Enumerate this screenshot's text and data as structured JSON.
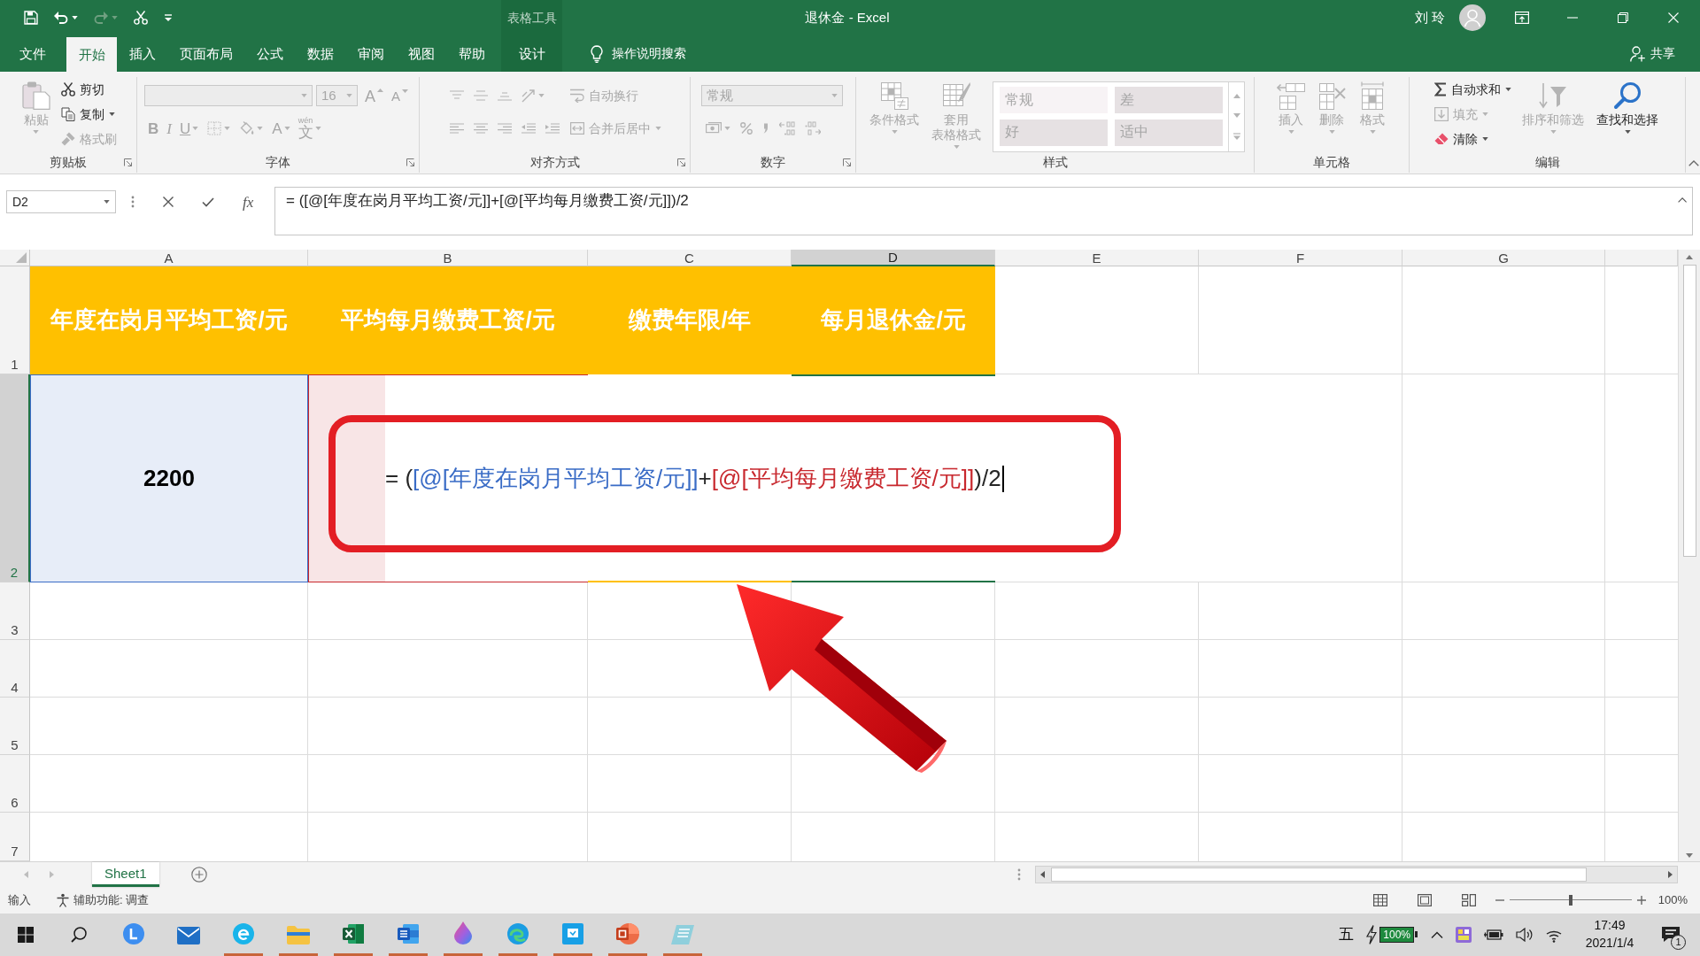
{
  "title_bar": {
    "quick_access": [
      {
        "disabled": false,
        "dropdown": false
      },
      {
        "disabled": false,
        "dropdown": true
      },
      {
        "disabled": true,
        "dropdown": true
      },
      {
        "disabled": false,
        "dropdown": false
      },
      {
        "disabled": false,
        "dropdown": false
      }
    ],
    "contextual_group": "表格工具",
    "title": "退休金 - Excel",
    "user": "刘 玲"
  },
  "ribbon_tabs": [
    {
      "label": "文件",
      "kind": "standard",
      "selected": false
    },
    {
      "label": "开始",
      "kind": "standard",
      "selected": true
    },
    {
      "label": "插入",
      "kind": "standard",
      "selected": false
    },
    {
      "label": "页面布局",
      "kind": "standard",
      "selected": false
    },
    {
      "label": "公式",
      "kind": "standard",
      "selected": false
    },
    {
      "label": "数据",
      "kind": "standard",
      "selected": false
    },
    {
      "label": "审阅",
      "kind": "standard",
      "selected": false
    },
    {
      "label": "视图",
      "kind": "standard",
      "selected": false
    },
    {
      "label": "帮助",
      "kind": "standard",
      "selected": false
    },
    {
      "label": "设计",
      "kind": "contextual",
      "selected": false
    }
  ],
  "tell_me": "操作说明搜索",
  "share": "共享",
  "ribbon_groups": [
    {
      "label": "剪贴板",
      "dialog_launcher": true,
      "columns": [
        [
          [
            {
              "kind": "large",
              "label": "粘贴",
              "disabled": true,
              "dropdown": true
            }
          ]
        ],
        [
          [
            {
              "kind": "small",
              "label": "剪切",
              "disabled": false,
              "dropdown": false
            }
          ],
          [
            {
              "kind": "small",
              "label": "复制",
              "disabled": false,
              "dropdown": true
            }
          ],
          [
            {
              "kind": "small",
              "label": "格式刷",
              "disabled": true,
              "dropdown": false
            }
          ]
        ]
      ]
    },
    {
      "label": "字体",
      "dialog_launcher": true,
      "columns": [
        [
          [
            {
              "kind": "field",
              "disabled": true,
              "dropdown": true
            },
            {
              "kind": "field",
              "value": "16",
              "disabled": true,
              "dropdown": true
            },
            {
              "kind": "glyph",
              "label": "A",
              "disabled": true,
              "dropdown": false
            },
            {
              "kind": "glyph",
              "label": "A",
              "disabled": true,
              "dropdown": false
            }
          ],
          [
            {
              "kind": "glyph",
              "label": "B",
              "disabled": true,
              "dropdown": false
            },
            {
              "kind": "glyph",
              "label": "I",
              "disabled": true,
              "dropdown": false
            },
            {
              "kind": "glyph",
              "label": "U",
              "disabled": true,
              "dropdown": true
            },
            {
              "kind": "icon",
              "disabled": true,
              "dropdown": true
            },
            {
              "kind": "icon",
              "disabled": true,
              "dropdown": true
            },
            {
              "kind": "glyph",
              "label": "A",
              "disabled": true,
              "dropdown": true
            },
            {
              "kind": "glyph",
              "label": "文",
              "ruby": "wén",
              "disabled": true,
              "dropdown": true
            }
          ]
        ]
      ]
    },
    {
      "label": "对齐方式",
      "dialog_launcher": true,
      "columns": [
        [
          [
            {
              "kind": "icon",
              "disabled": true,
              "dropdown": false
            },
            {
              "kind": "icon",
              "disabled": true,
              "dropdown": false
            },
            {
              "kind": "icon",
              "disabled": true,
              "dropdown": false
            },
            {
              "kind": "icon",
              "disabled": true,
              "dropdown": true
            }
          ],
          [
            {
              "kind": "icon",
              "disabled": true,
              "dropdown": false
            },
            {
              "kind": "icon",
              "disabled": true,
              "dropdown": false
            },
            {
              "kind": "icon",
              "disabled": true,
              "dropdown": false
            },
            {
              "kind": "icon",
              "disabled": true,
              "dropdown": false
            },
            {
              "kind": "icon",
              "disabled": true,
              "dropdown": false
            }
          ]
        ],
        [
          [
            {
              "kind": "small",
              "label": "自动换行",
              "disabled": true,
              "dropdown": false
            }
          ],
          [
            {
              "kind": "small",
              "label": "合并后居中",
              "disabled": true,
              "dropdown": true
            }
          ]
        ]
      ]
    },
    {
      "label": "数字",
      "dialog_launcher": true,
      "columns": [
        [
          [
            {
              "kind": "field",
              "value": "常规",
              "disabled": true,
              "dropdown": true
            }
          ],
          [
            {
              "kind": "icon",
              "disabled": true,
              "dropdown": true
            },
            {
              "kind": "icon",
              "disabled": true,
              "dropdown": false
            },
            {
              "kind": "icon",
              "disabled": true,
              "dropdown": false
            },
            {
              "kind": "icon",
              "disabled": true,
              "dropdown": false
            },
            {
              "kind": "icon",
              "disabled": true,
              "dropdown": false
            }
          ]
        ]
      ]
    },
    {
      "label": "样式",
      "dialog_launcher": false,
      "columns": [
        [
          [
            {
              "kind": "large",
              "label": "条件格式",
              "disabled": true,
              "dropdown": true
            }
          ]
        ],
        [
          [
            {
              "kind": "large",
              "label": "套用表格格式",
              "disabled": true,
              "dropdown": true
            }
          ]
        ],
        [
          [
            {
              "kind": "gallery",
              "disabled": true,
              "styles": [
                {
                  "label": "常规",
                  "color": "#f7f3f5"
                },
                {
                  "label": "差",
                  "color": "#e6e1e3"
                },
                {
                  "label": "好",
                  "color": "#e6e1e3"
                },
                {
                  "label": "适中",
                  "color": "#e6e1e3"
                }
              ]
            }
          ]
        ]
      ]
    },
    {
      "label": "单元格",
      "dialog_launcher": false,
      "columns": [
        [
          [
            {
              "kind": "large",
              "label": "插入",
              "disabled": true,
              "dropdown": true
            }
          ]
        ],
        [
          [
            {
              "kind": "large",
              "label": "删除",
              "disabled": true,
              "dropdown": true
            }
          ]
        ],
        [
          [
            {
              "kind": "large",
              "label": "格式",
              "disabled": true,
              "dropdown": true
            }
          ]
        ]
      ]
    },
    {
      "label": "编辑",
      "dialog_launcher": false,
      "columns": [
        [
          [
            {
              "kind": "small",
              "label": "自动求和",
              "disabled": false,
              "dropdown": true
            }
          ],
          [
            {
              "kind": "small",
              "label": "填充",
              "disabled": true,
              "dropdown": true
            }
          ],
          [
            {
              "kind": "small",
              "label": "清除",
              "disabled": false,
              "dropdown": true
            }
          ]
        ],
        [
          [
            {
              "kind": "large",
              "label": "排序和筛选",
              "disabled": true,
              "dropdown": true
            }
          ]
        ],
        [
          [
            {
              "kind": "large",
              "label": "查找和选择",
              "disabled": false,
              "dropdown": true
            }
          ]
        ]
      ]
    }
  ],
  "formula_bar": {
    "name_box": "D2",
    "insert_function": "fx",
    "formula": "= ([@[年度在岗月平均工资/元]]+[@[平均每月缴费工资/元]])/2"
  },
  "sheet": {
    "columns": [
      {
        "label": "A",
        "selected": false
      },
      {
        "label": "B",
        "selected": false
      },
      {
        "label": "C",
        "selected": false
      },
      {
        "label": "D",
        "selected": true
      },
      {
        "label": "E",
        "selected": false
      },
      {
        "label": "F",
        "selected": false
      },
      {
        "label": "G",
        "selected": false
      }
    ],
    "rows": [
      {
        "label": "1",
        "selected": false,
        "cells": [
          {
            "kind": "header",
            "text": "年度在岗月平均工资/元"
          },
          {
            "kind": "header",
            "text": "平均每月缴费工资/元"
          },
          {
            "kind": "header",
            "text": "缴费年限/年"
          },
          {
            "kind": "header",
            "text": "每月退休金/元"
          }
        ]
      },
      {
        "label": "2",
        "selected": true,
        "cells": [
          {
            "kind": "value",
            "text": "2200",
            "color": "#3a6cc6"
          },
          {
            "kind": "blank",
            "color": "#c8282e"
          },
          {
            "kind": "blank"
          },
          {
            "kind": "active"
          }
        ]
      },
      {
        "label": "3",
        "selected": false
      },
      {
        "label": "4",
        "selected": false
      },
      {
        "label": "5",
        "selected": false
      },
      {
        "label": "6",
        "selected": false
      },
      {
        "label": "7",
        "selected": false
      }
    ],
    "editor": {
      "parts": [
        {
          "text": "= (",
          "color": "#262626"
        },
        {
          "text": "[@[年度在岗月平均工资/元]]",
          "color": "#3a6cc6"
        },
        {
          "text": "+",
          "color": "#262626"
        },
        {
          "text": "[@[平均每月缴费工资/元]]",
          "color": "#c8282e"
        },
        {
          "text": ")/2",
          "color": "#262626"
        }
      ]
    }
  },
  "sheet_tabs": [
    {
      "label": "Sheet1",
      "selected": true
    }
  ],
  "status_bar": {
    "mode": "输入",
    "accessibility": "辅助功能: 调查",
    "zoom": {
      "level": 0.5,
      "reading": "100%"
    }
  },
  "taskbar": {
    "apps": [
      {
        "running": false
      },
      {
        "running": false
      },
      {
        "running": true
      },
      {
        "running": true
      },
      {
        "running": true
      },
      {
        "running": true
      },
      {
        "running": true
      },
      {
        "running": true
      },
      {
        "running": true
      },
      {
        "running": true
      },
      {
        "running": true
      }
    ],
    "ime": "五",
    "battery": "100%",
    "time": "17:49",
    "date": "2021/1/4",
    "notifications": "1"
  }
}
